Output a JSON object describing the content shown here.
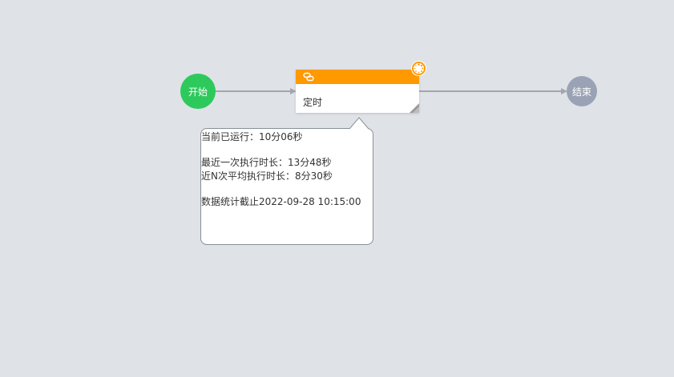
{
  "flow": {
    "start_node": {
      "label": "开始"
    },
    "task_node": {
      "label": "定时"
    },
    "end_node": {
      "label": "结束"
    }
  },
  "tooltip": {
    "current_runtime": "当前已运行：10分06秒",
    "last_duration": "最近一次执行时长：13分48秒",
    "avg_duration": "近N次平均执行时长：8分30秒",
    "stats_cutoff": "数据统计截止2022-09-28 10:15:00"
  },
  "icons": {
    "task_header": "link-icon",
    "status": "spinner-icon",
    "corner": "resize-handle-icon"
  },
  "colors": {
    "canvas_background": "#dfe3e8",
    "start_node": "#2ec95c",
    "end_node": "#9aa3b5",
    "task_header": "#ff9900",
    "edge": "#a3a7ad",
    "tooltip_border": "#8a8f96"
  }
}
